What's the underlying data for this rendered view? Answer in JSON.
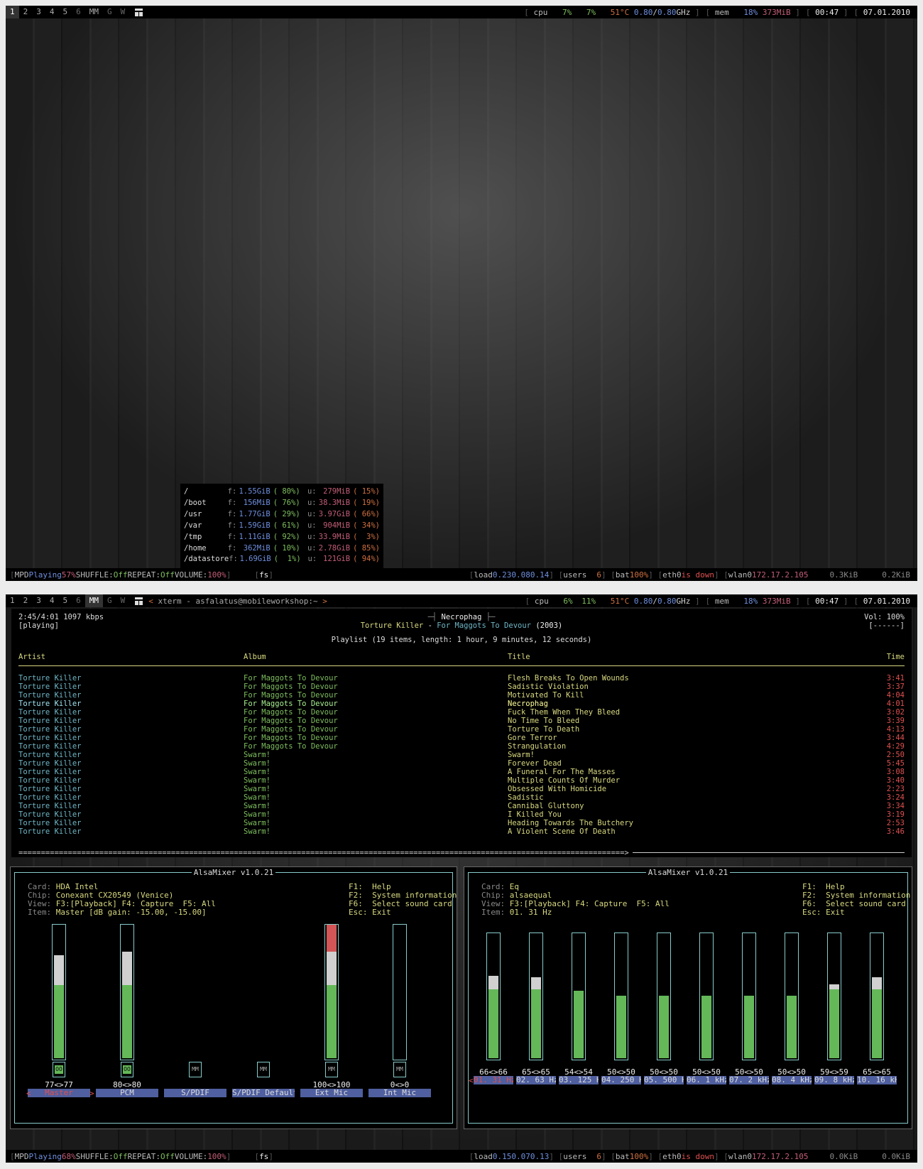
{
  "screen1": {
    "tags": [
      "1",
      "2",
      "3",
      "4",
      "5",
      "6",
      "MM",
      "G",
      "W"
    ],
    "status": {
      "cpu_label": "cpu",
      "cpu1": "7%",
      "cpu2": "7%",
      "temp": "51°C",
      "freq1": "0.80",
      "freq_sep": "/",
      "freq2": "0.80",
      "freq_unit": "GHz",
      "mem_label": "mem",
      "mem_pct": "18%",
      "mem_used": "373MiB",
      "time": "00:47",
      "date": "07.01.2010"
    },
    "filesystems": [
      {
        "mount": "/",
        "free": "1.55GiB",
        "free_pct": "( 80%)",
        "used": "279MiB",
        "used_pct": "( 15%)"
      },
      {
        "mount": "/boot",
        "free": "156MiB",
        "free_pct": "( 76%)",
        "used": "38.3MiB",
        "used_pct": "( 19%)"
      },
      {
        "mount": "/usr",
        "free": "1.77GiB",
        "free_pct": "( 29%)",
        "used": "3.97GiB",
        "used_pct": "( 66%)"
      },
      {
        "mount": "/var",
        "free": "1.59GiB",
        "free_pct": "( 61%)",
        "used": "904MiB",
        "used_pct": "( 34%)"
      },
      {
        "mount": "/tmp",
        "free": "1.11GiB",
        "free_pct": "( 92%)",
        "used": "33.9MiB",
        "used_pct": "(  3%)"
      },
      {
        "mount": "/home",
        "free": "362MiB",
        "free_pct": "( 10%)",
        "used": "2.78GiB",
        "used_pct": "( 85%)"
      },
      {
        "mount": "/datastore",
        "free": "1.69GiB",
        "free_pct": "(  1%)",
        "used": "121GiB",
        "used_pct": "( 94%)"
      }
    ],
    "fs_free_label": "f:",
    "fs_used_label": "u:",
    "bottom": {
      "mpd": "MPD",
      "state": "Playing",
      "pct": "57%",
      "shuffle_label": "SHUFFLE:",
      "shuffle": "Off",
      "repeat_label": "REPEAT:",
      "repeat": "Off",
      "volume_label": "VOLUME:",
      "volume": "100%",
      "fs": "fs",
      "load_label": "load",
      "load1": "0.23",
      "load5": "0.08",
      "load15": "0.14",
      "users_label": "users",
      "users": "6",
      "bat_label": "bat",
      "bat": "100%",
      "eth_label": "eth0",
      "eth": "is down",
      "wlan_label": "wlan0",
      "wlan_ip": "172.17.2.105",
      "down": "0.3KiB",
      "up": "0.2KiB"
    }
  },
  "screen2": {
    "tags": [
      "1",
      "2",
      "3",
      "4",
      "5",
      "6",
      "MM",
      "G",
      "W"
    ],
    "window_title": "xterm - asfalatus@mobileworkshop:~",
    "status": {
      "cpu_label": "cpu",
      "cpu1": "6%",
      "cpu2": "11%",
      "temp": "51°C",
      "freq1": "0.80",
      "freq_sep": "/",
      "freq2": "0.80",
      "freq_unit": "GHz",
      "mem_label": "mem",
      "mem_pct": "18%",
      "mem_used": "373MiB",
      "time": "00:47",
      "date": "07.01.2010"
    },
    "ncmpcpp": {
      "elapsed": "2:45/4:01 1097 kbps",
      "state": "[playing]",
      "song_title": "Necrophag",
      "artist": "Torture Killer",
      "dash": "-",
      "album": "For Maggots To Devour",
      "year": "(2003)",
      "vol": "Vol: 100%",
      "flags": "[------]",
      "playlist_info": "Playlist (19 items, length: 1 hour, 9 minutes, 12 seconds)",
      "columns": [
        "Artist",
        "Album",
        "Title",
        "Time"
      ],
      "progress": "=======================================================================================================================================>",
      "rows": [
        [
          "Torture Killer",
          "For Maggots To Devour",
          "Flesh Breaks To Open Wounds",
          "3:41"
        ],
        [
          "Torture Killer",
          "For Maggots To Devour",
          "Sadistic Violation",
          "3:37"
        ],
        [
          "Torture Killer",
          "For Maggots To Devour",
          "Motivated To Kill",
          "4:04"
        ],
        [
          "Torture Killer",
          "For Maggots To Devour",
          "Necrophag",
          "4:01"
        ],
        [
          "Torture Killer",
          "For Maggots To Devour",
          "Fuck Them When They Bleed",
          "3:02"
        ],
        [
          "Torture Killer",
          "For Maggots To Devour",
          "No Time To Bleed",
          "3:39"
        ],
        [
          "Torture Killer",
          "For Maggots To Devour",
          "Torture To Death",
          "4:13"
        ],
        [
          "Torture Killer",
          "For Maggots To Devour",
          "Gore Terror",
          "3:44"
        ],
        [
          "Torture Killer",
          "For Maggots To Devour",
          "Strangulation",
          "4:29"
        ],
        [
          "Torture Killer",
          "Swarm!",
          "Swarm!",
          "2:50"
        ],
        [
          "Torture Killer",
          "Swarm!",
          "Forever Dead",
          "5:45"
        ],
        [
          "Torture Killer",
          "Swarm!",
          "A Funeral For The Masses",
          "3:08"
        ],
        [
          "Torture Killer",
          "Swarm!",
          "Multiple Counts Of Murder",
          "3:40"
        ],
        [
          "Torture Killer",
          "Swarm!",
          "Obsessed With Homicide",
          "2:23"
        ],
        [
          "Torture Killer",
          "Swarm!",
          "Sadistic",
          "3:24"
        ],
        [
          "Torture Killer",
          "Swarm!",
          "Cannibal Gluttony",
          "3:34"
        ],
        [
          "Torture Killer",
          "Swarm!",
          "I Killed You",
          "3:19"
        ],
        [
          "Torture Killer",
          "Swarm!",
          "Heading Towards The Butchery",
          "2:53"
        ],
        [
          "Torture Killer",
          "Swarm!",
          "A Violent Scene Of Death",
          "3:46"
        ]
      ]
    },
    "mixer1": {
      "title": "AlsaMixer v1.0.21",
      "card_label": "Card:",
      "card": "HDA Intel",
      "chip_label": "Chip:",
      "chip": "Conexant CX20549 (Venice)",
      "view_label": "View:",
      "view": "F3:[Playback] F4: Capture  F5: All",
      "item_label": "Item:",
      "item": "Master [dB gain: -15.00, -15.00]",
      "help": [
        "F1:  Help",
        "F2:  System information",
        "F6:  Select sound card",
        "Esc: Exit"
      ],
      "mute_on": "OO",
      "mute_off": "MM",
      "channels": [
        {
          "name": "Master",
          "value": "77<>77",
          "level": 77,
          "mute": "on",
          "fader": true
        },
        {
          "name": "PCM",
          "value": "80<>80",
          "level": 80,
          "mute": "on",
          "fader": true
        },
        {
          "name": "S/PDIF",
          "value": "",
          "level": 0,
          "mute": "off",
          "fader": false
        },
        {
          "name": "S/PDIF Default",
          "value": "",
          "level": 0,
          "mute": "off",
          "fader": false
        },
        {
          "name": "Ext Mic",
          "value": "100<>100",
          "level": 100,
          "mute": "off",
          "fader": true
        },
        {
          "name": "Int Mic",
          "value": "0<>0",
          "level": 0,
          "mute": "off",
          "fader": true
        }
      ]
    },
    "mixer2": {
      "title": "AlsaMixer v1.0.21",
      "card_label": "Card:",
      "card": "Eq",
      "chip_label": "Chip:",
      "chip": "alsaequal",
      "view_label": "View:",
      "view": "F3:[Playback] F4: Capture  F5: All",
      "item_label": "Item:",
      "item": "01. 31 Hz",
      "help": [
        "F1:  Help",
        "F2:  System information",
        "F6:  Select sound card",
        "Esc: Exit"
      ],
      "channels": [
        {
          "name": "01. 31 Hz",
          "value": "66<>66",
          "level": 66
        },
        {
          "name": "02. 63 Hz",
          "value": "65<>65",
          "level": 65
        },
        {
          "name": "03. 125 H",
          "value": "54<>54",
          "level": 54
        },
        {
          "name": "04. 250 H",
          "value": "50<>50",
          "level": 50
        },
        {
          "name": "05. 500 H",
          "value": "50<>50",
          "level": 50
        },
        {
          "name": "06. 1 kHz",
          "value": "50<>50",
          "level": 50
        },
        {
          "name": "07. 2 kHz",
          "value": "50<>50",
          "level": 50
        },
        {
          "name": "08. 4 kHz",
          "value": "50<>50",
          "level": 50
        },
        {
          "name": "09. 8 kHz",
          "value": "59<>59",
          "level": 59
        },
        {
          "name": "10. 16 kH",
          "value": "65<>65",
          "level": 65
        }
      ]
    },
    "bottom": {
      "mpd": "MPD",
      "state": "Playing",
      "pct": "68%",
      "shuffle_label": "SHUFFLE:",
      "shuffle": "Off",
      "repeat_label": "REPEAT:",
      "repeat": "Off",
      "volume_label": "VOLUME:",
      "volume": "100%",
      "fs": "fs",
      "load_label": "load",
      "load1": "0.15",
      "load5": "0.07",
      "load15": "0.13",
      "users_label": "users",
      "users": "6",
      "bat_label": "bat",
      "bat": "100%",
      "eth_label": "eth0",
      "eth": "is down",
      "wlan_label": "wlan0",
      "wlan_ip": "172.17.2.105",
      "down": "0.0KiB",
      "up": "0.0KiB"
    }
  }
}
